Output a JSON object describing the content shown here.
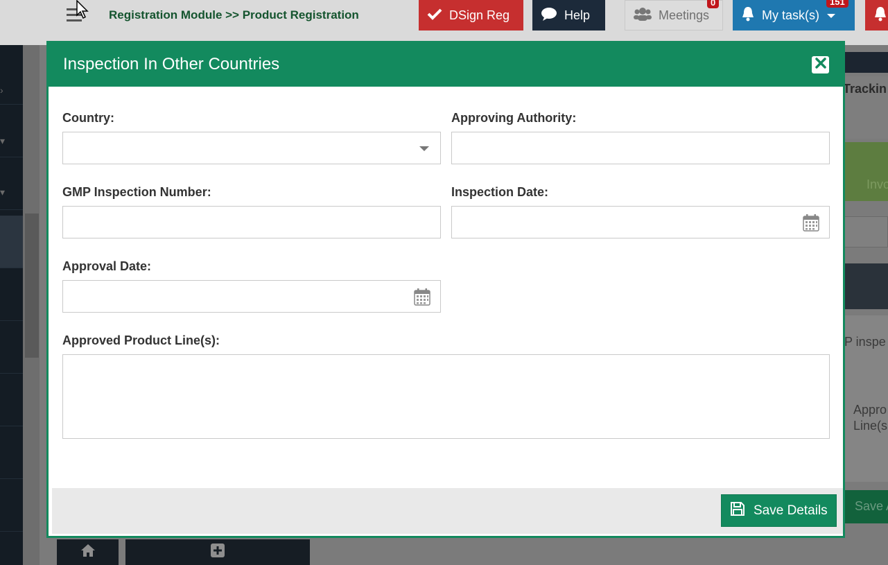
{
  "header": {
    "breadcrumb": "Registration Module >> Product Registration",
    "buttons": {
      "dsign": "DSign Reg",
      "help": "Help",
      "meetings": "Meetings",
      "meetings_badge": "0",
      "tasks": "My task(s)",
      "tasks_badge": "151"
    }
  },
  "background": {
    "tracking": "Trackin",
    "invoice": "Invo",
    "gmp_inspection": "P inspe",
    "approved_line_1": "Appro",
    "approved_line_2": "Line(s",
    "save_partial": "Save A"
  },
  "modal": {
    "title": "Inspection In Other Countries",
    "fields": {
      "country": {
        "label": "Country:",
        "value": ""
      },
      "approving_authority": {
        "label": "Approving Authority:",
        "value": ""
      },
      "gmp_number": {
        "label": "GMP Inspection Number:",
        "value": ""
      },
      "inspection_date": {
        "label": "Inspection Date:",
        "value": ""
      },
      "approval_date": {
        "label": "Approval Date:",
        "value": ""
      },
      "product_lines": {
        "label": "Approved Product Line(s):",
        "value": ""
      }
    },
    "save_label": "Save Details"
  },
  "colors": {
    "primary_green": "#138a5e",
    "danger_red": "#c62f2f",
    "info_blue": "#1f78b0",
    "breadcrumb_green": "#14542e"
  }
}
